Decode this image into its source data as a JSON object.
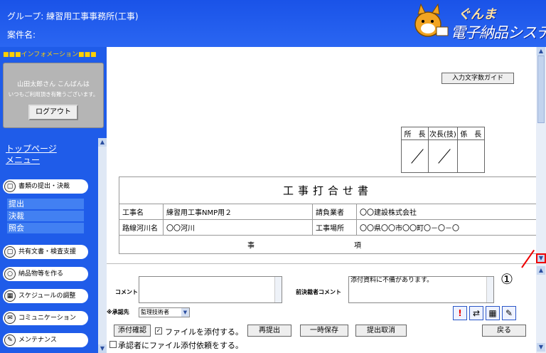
{
  "header": {
    "group": "グループ: 練習用工事事務所(工事)",
    "case_name": "案件名:",
    "logo_line1": "ぐんま",
    "logo_line2": "電子納品システム"
  },
  "sidebar": {
    "info_heading": "■■■インフォメーション■■■",
    "user_name": "山田太郎さん こんばんは",
    "user_thanks": "いつもご利用頂き有難うございます。",
    "logout": "ログアウト",
    "top_page": "トップページ",
    "menu": "メニュー",
    "items": [
      {
        "label": "書類の提出・決裁",
        "icon": "document-icon"
      },
      {
        "label": "共有文書・検査支援",
        "icon": "document-icon"
      },
      {
        "label": "納品物等を作る",
        "icon": "oval-icon"
      },
      {
        "label": "スケジュールの調整",
        "icon": "calendar-icon"
      },
      {
        "label": "コミュニケーション",
        "icon": "mail-icon"
      },
      {
        "label": "メンテナンス",
        "icon": "wrench-icon"
      }
    ],
    "subitems": [
      "提出",
      "決裁",
      "照会"
    ]
  },
  "content": {
    "guide_button": "入力文字数ガイド",
    "stamp_headers": [
      "所　長",
      "次長(技)",
      "係　長"
    ],
    "doc_title": "工事打合せ書",
    "rows": [
      {
        "l1": "工事名",
        "v1": "練習用工事NMP用２",
        "l2": "請負業者",
        "v2": "〇〇建設株式会社"
      },
      {
        "l1": "路線河川名",
        "v1": "〇〇河川",
        "l2": "工事場所",
        "v2": "〇〇県〇〇市〇〇町〇－〇－〇"
      }
    ],
    "section_label_a": "事",
    "section_label_b": "項"
  },
  "panel": {
    "comment_label": "コメント",
    "prev_comment_label": "前決裁者コメント",
    "prev_comment_text": "添付資料に不備があります。",
    "approver_label": "※承認先",
    "approver_value": "監理技術者",
    "attach_confirm": "添付確認",
    "attach_checkbox_label": "ファイルを添付する。",
    "resubmit": "再提出",
    "temp_save": "一時保存",
    "cancel_submit": "提出取消",
    "back": "戻る",
    "request_checkbox_label": "承認者にファイル添付依頼をする。"
  },
  "annotation": {
    "marker": "①",
    "accent": "#e00000"
  }
}
